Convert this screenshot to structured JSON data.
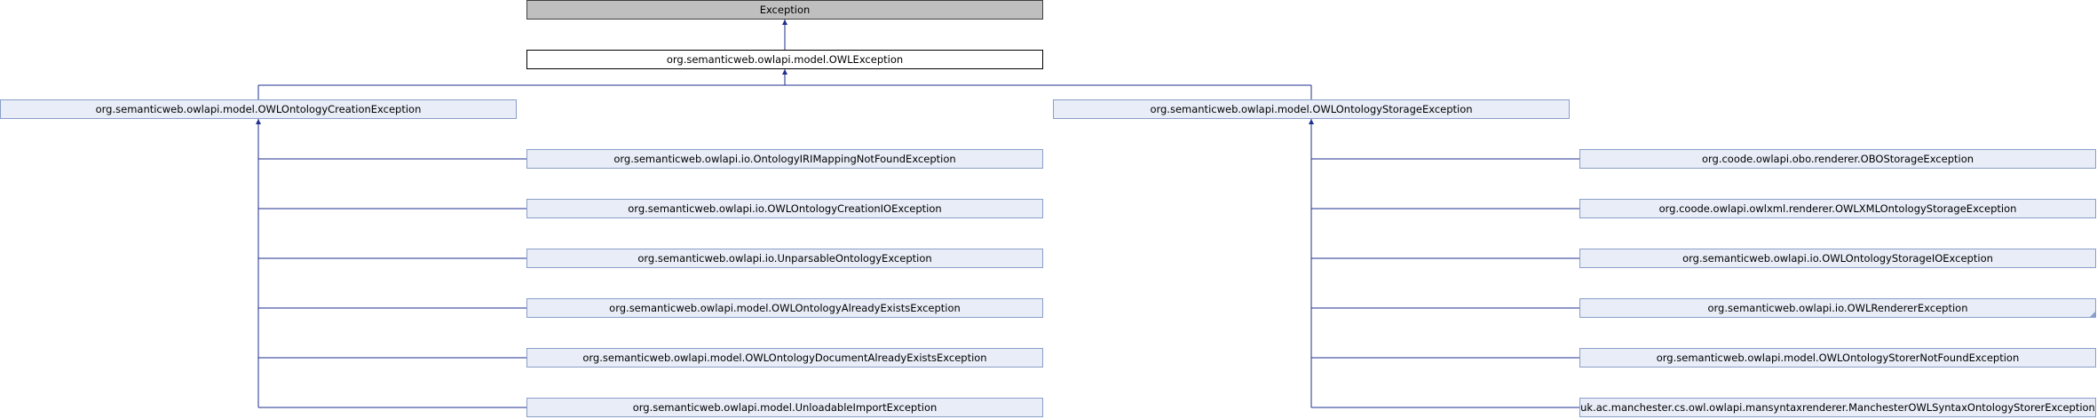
{
  "diagram": {
    "colors": {
      "edge": "#1f2f8f",
      "node_fill": "#e8edf7",
      "node_border": "#8a9fc8",
      "base_fill": "#bfbfbf",
      "current_fill": "#ffffff"
    },
    "root": "Exception",
    "current": "org.semanticweb.owlapi.model.OWLException",
    "branches": [
      {
        "parent": "org.semanticweb.owlapi.model.OWLOntologyCreationException",
        "children": [
          "org.semanticweb.owlapi.io.OntologyIRIMappingNotFoundException",
          "org.semanticweb.owlapi.io.OWLOntologyCreationIOException",
          "org.semanticweb.owlapi.io.UnparsableOntologyException",
          "org.semanticweb.owlapi.model.OWLOntologyAlreadyExistsException",
          "org.semanticweb.owlapi.model.OWLOntologyDocumentAlreadyExistsException",
          "org.semanticweb.owlapi.model.UnloadableImportException"
        ]
      },
      {
        "parent": "org.semanticweb.owlapi.model.OWLOntologyStorageException",
        "children": [
          "org.coode.owlapi.obo.renderer.OBOStorageException",
          "org.coode.owlapi.owlxml.renderer.OWLXMLOntologyStorageException",
          "org.semanticweb.owlapi.io.OWLOntologyStorageIOException",
          "org.semanticweb.owlapi.io.OWLRendererException",
          "org.semanticweb.owlapi.model.OWLOntologyStorerNotFoundException",
          "uk.ac.manchester.cs.owl.owlapi.mansyntaxrenderer.ManchesterOWLSyntaxOntologyStorerException"
        ]
      }
    ]
  }
}
